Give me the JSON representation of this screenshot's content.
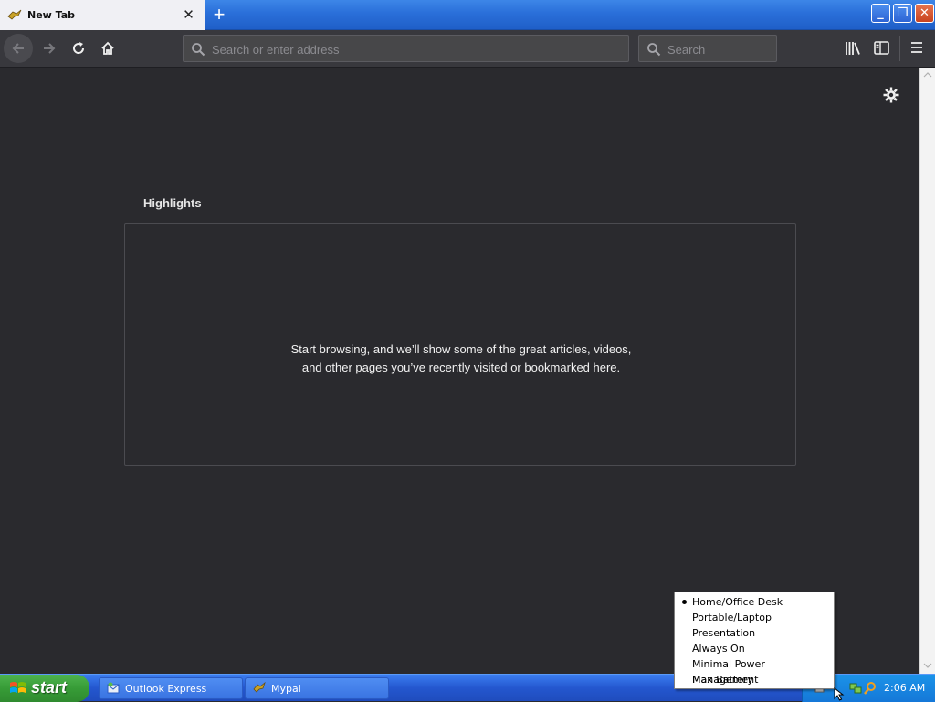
{
  "browser": {
    "tab": {
      "title": "New Tab"
    },
    "address_bar": {
      "placeholder": "Search or enter address"
    },
    "search_bar": {
      "placeholder": "Search"
    }
  },
  "newtab": {
    "highlights_title": "Highlights",
    "highlights_message": "Start browsing, and we’ll show some of the great articles, videos, and other pages you’ve recently visited or bookmarked here."
  },
  "taskbar": {
    "start_label": "start",
    "tasks": [
      {
        "label": "Outlook Express"
      },
      {
        "label": "Mypal"
      }
    ],
    "clock": "2:06 AM"
  },
  "power_menu": {
    "items": [
      {
        "label": "Home/Office Desk",
        "selected": true
      },
      {
        "label": "Portable/Laptop",
        "selected": false
      },
      {
        "label": "Presentation",
        "selected": false
      },
      {
        "label": "Always On",
        "selected": false
      },
      {
        "label": "Minimal Power Management",
        "selected": false
      },
      {
        "label": "Max Battery",
        "selected": false
      }
    ]
  },
  "colors": {
    "page_background": "#2a2a2e",
    "toolbar": "#38383d",
    "xp_blue": "#2457cf",
    "start_green": "#379c37"
  }
}
